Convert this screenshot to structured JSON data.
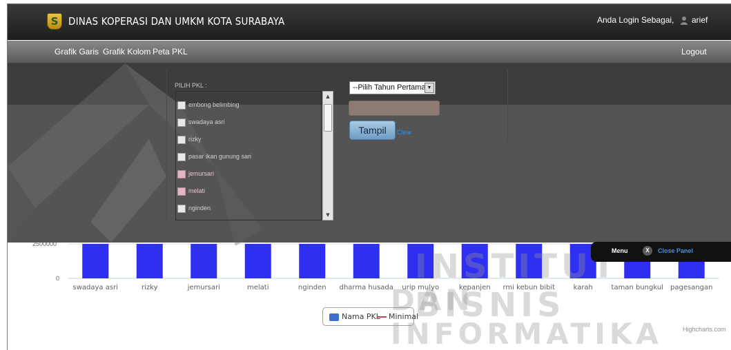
{
  "header": {
    "title": "DINAS KOPERASI DAN UMKM KOTA SURABAYA",
    "logo_glyph": "S",
    "login_text": "Anda Login Sebagai,",
    "user_name": "arief",
    "user_icon": "user-icon"
  },
  "nav": {
    "items": [
      "Grafik Garis",
      "Grafik Kolom",
      "Peta PKL"
    ],
    "logout": "Logout"
  },
  "filter": {
    "title": "PILIH PKL :",
    "options": [
      {
        "label": "embong belimbing",
        "checked": false
      },
      {
        "label": "swadaya asri",
        "checked": false
      },
      {
        "label": "rizky",
        "checked": false
      },
      {
        "label": "pasar ikan gunung sari",
        "checked": false
      },
      {
        "label": "jemursari",
        "checked": false
      },
      {
        "label": "melati",
        "checked": false
      },
      {
        "label": "nginden",
        "checked": false
      }
    ],
    "year_select": "--Pilih Tahun Pertama--",
    "year_input_value": "",
    "tampil_button": "Tampil",
    "clear_link": "Clear"
  },
  "panel_tab": {
    "menu_label": "Menu",
    "close_glyph": "X",
    "close_label": "Close Panel"
  },
  "chart_data": {
    "type": "bar",
    "categories": [
      "swadaya asri",
      "rizky",
      "jemursari",
      "melati",
      "nginden",
      "dharma husada",
      "urip mulyo",
      "kepanjen",
      "rmi kebun bibit",
      "karah",
      "taman bungkul",
      "pagesangan"
    ],
    "series": [
      {
        "name": "Nama PKL",
        "values": [
          2500000,
          2500000,
          2500000,
          2500000,
          2500000,
          2500000,
          2500000,
          2500000,
          2500000,
          2500000,
          2500000,
          2500000
        ]
      },
      {
        "name": "Minimal",
        "values": []
      }
    ],
    "y_ticks": [
      "2500000",
      "0"
    ],
    "ylim": [
      0,
      2500000
    ],
    "bar_color": "#2f2ff2",
    "minimal_color": "#b84a4a",
    "legend": "bottom-center",
    "credit": "Highcharts.com"
  },
  "watermark": {
    "line1": "INSTITUT BISNIS",
    "line2": "DAN INFORMATIKA"
  }
}
